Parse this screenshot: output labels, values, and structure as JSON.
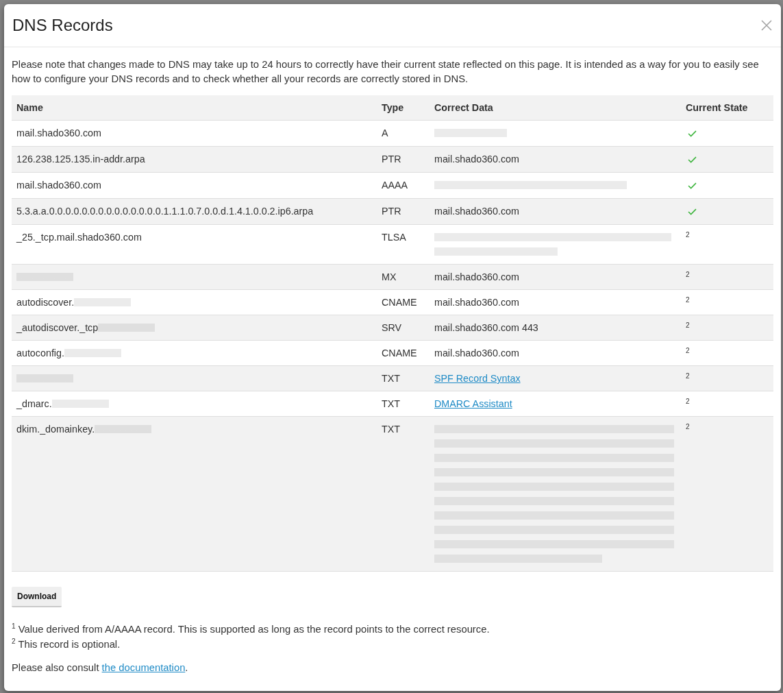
{
  "dialog": {
    "title": "DNS Records",
    "intro": "Please note that changes made to DNS may take up to 24 hours to correctly have their current state reflected on this page. It is intended as a way for you to easily see how to configure your DNS records and to check whether all your records are correctly stored in DNS.",
    "table": {
      "columns": [
        "Name",
        "Type",
        "Correct Data",
        "Current State"
      ],
      "rows": [
        {
          "name": "mail.shado360.com",
          "name_blurred": false,
          "type": "A",
          "data": {
            "kind": "shortblur"
          },
          "verified": true
        },
        {
          "name": "126.238.125.135.in-addr.arpa",
          "name_blurred": false,
          "type": "PTR",
          "data": {
            "kind": "text",
            "text": "mail.shado360.com"
          },
          "verified": true
        },
        {
          "name": "mail.shado360.com",
          "name_blurred": false,
          "type": "AAAA",
          "data": {
            "kind": "longblur"
          },
          "verified": true
        },
        {
          "name": "5.3.a.a.0.0.0.0.0.0.0.0.0.0.0.0.0.0.1.1.1.0.7.0.0.d.1.4.1.0.0.2.ip6.arpa",
          "name_blurred": false,
          "type": "PTR",
          "data": {
            "kind": "text",
            "text": "mail.shado360.com"
          },
          "verified": true
        },
        {
          "name": "_25._tcp.mail.shado360.com",
          "name_blurred": false,
          "type": "TLSA",
          "data": {
            "kind": "wrappedblur"
          },
          "verified": false,
          "note": "2"
        },
        {
          "name_blurred": true,
          "type": "MX",
          "data": {
            "kind": "text",
            "text": "mail.shado360.com"
          },
          "verified": false,
          "note": "2"
        },
        {
          "name": "autodiscover.",
          "name_blurred": true,
          "type": "CNAME",
          "data": {
            "kind": "text",
            "text": "mail.shado360.com"
          },
          "verified": false,
          "note": "2"
        },
        {
          "name": "_autodiscover._tcp",
          "name_blurred": true,
          "type": "SRV",
          "data": {
            "kind": "text",
            "text": "mail.shado360.com 443"
          },
          "verified": false,
          "note": "2"
        },
        {
          "name": "autoconfig.",
          "name_blurred": true,
          "type": "CNAME",
          "data": {
            "kind": "text",
            "text": "mail.shado360.com"
          },
          "verified": false,
          "note": "2"
        },
        {
          "name_blurred": true,
          "type": "TXT",
          "data": {
            "kind": "link",
            "text": "SPF Record Syntax"
          },
          "verified": false,
          "note": "2"
        },
        {
          "name": "_dmarc.",
          "name_blurred": true,
          "type": "TXT",
          "data": {
            "kind": "link",
            "text": "DMARC Assistant"
          },
          "verified": false,
          "note": "2"
        },
        {
          "name": "dkim._domainkey.",
          "name_blurred": true,
          "type": "TXT",
          "data": {
            "kind": "blockblur"
          },
          "verified": false,
          "note": "2"
        }
      ]
    },
    "download_button": "Download",
    "footnotes": [
      "$^{1}$ Value derived from A/AAAA record. This is supported as long as the record points to the correct resource.",
      "$^{2}$ This record is optional."
    ],
    "consult": {
      "text": "Please also consult ",
      "link": "the documentation",
      "end": "."
    }
  }
}
